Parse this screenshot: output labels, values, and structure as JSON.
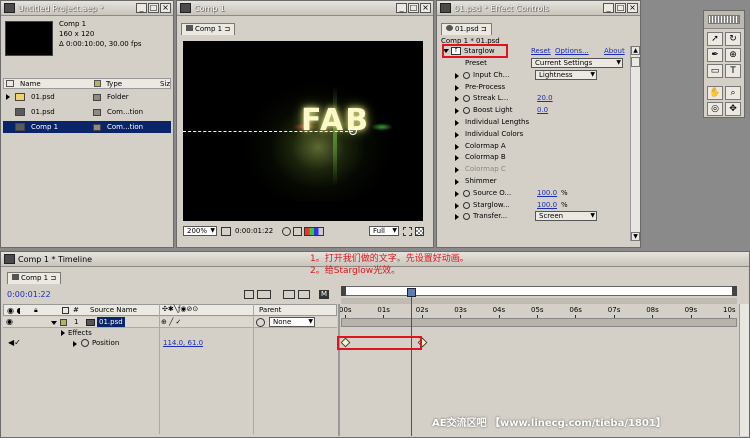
{
  "project": {
    "title": "Untitled Project.aep *",
    "comp_name": "Comp 1",
    "comp_size": "160 x 120",
    "comp_duration": "Δ 0:00:10:00, 30.00 fps",
    "col_name": "Name",
    "col_type": "Type",
    "col_size": "Siz",
    "items": [
      {
        "name": "01.psd",
        "type": "Folder",
        "icon": "folder-icon"
      },
      {
        "name": "01.psd",
        "type": "Com...tion",
        "icon": "psd-file-icon"
      },
      {
        "name": "Comp 1",
        "type": "Com...tion",
        "icon": "composition-icon"
      }
    ]
  },
  "comp": {
    "title": "Comp 1",
    "tab": "Comp 1",
    "overlay_text": "FAB",
    "zoom": "200%",
    "time": "0:00:01:22",
    "resolution": "Full"
  },
  "effects": {
    "title": "01.psd * Effect Controls",
    "tab": "01.psd",
    "breadcrumb": "Comp 1 * 01.psd",
    "effect_name": "Starglow",
    "reset": "Reset",
    "options": "Options...",
    "about": "About",
    "rows": [
      {
        "label": "Preset",
        "value": "Current Settings",
        "kind": "dropdown"
      },
      {
        "label": "Input Ch...",
        "value": "Lightness",
        "kind": "dropdown"
      },
      {
        "label": "Pre-Process",
        "value": "",
        "kind": "group"
      },
      {
        "label": "Streak L...",
        "value": "20.0",
        "kind": "value"
      },
      {
        "label": "Boost Light",
        "value": "0.0",
        "kind": "value"
      },
      {
        "label": "Individual Lengths",
        "value": "",
        "kind": "group"
      },
      {
        "label": "Individual Colors",
        "value": "",
        "kind": "group"
      },
      {
        "label": "Colormap A",
        "value": "",
        "kind": "group"
      },
      {
        "label": "Colormap B",
        "value": "",
        "kind": "group"
      },
      {
        "label": "Colormap C",
        "value": "",
        "kind": "group-dim"
      },
      {
        "label": "Shimmer",
        "value": "",
        "kind": "group"
      },
      {
        "label": "Source O...",
        "value": "100.0",
        "unit": "%",
        "kind": "value"
      },
      {
        "label": "Starglow...",
        "value": "100.0",
        "unit": "%",
        "kind": "value"
      },
      {
        "label": "Transfer...",
        "value": "Screen",
        "kind": "dropdown"
      }
    ]
  },
  "timeline": {
    "title": "Comp 1 * Timeline",
    "tab": "Comp 1",
    "current_time": "0:00:01:22",
    "col_number": "#",
    "col_source": "Source Name",
    "col_parent": "Parent",
    "layer": {
      "index": "1",
      "name": "01.psd",
      "parent": "None"
    },
    "effects_label": "Effects",
    "position_label": "Position",
    "position_value": "114.0, 61.0",
    "ruler": [
      "00s",
      "01s",
      "02s",
      "03s",
      "04s",
      "05s",
      "06s",
      "07s",
      "08s",
      "09s",
      "10s"
    ],
    "playhead_seconds": 1.73,
    "keyframes_seconds": [
      0,
      2
    ]
  },
  "annotation": {
    "line1": "1。打开我们做的文字。先设置好动画。",
    "line2": "2。给Starglow光效。",
    "color": "#e0141c"
  },
  "watermark": "AE交流区吧 【www.linecg.com/tieba/1801】"
}
